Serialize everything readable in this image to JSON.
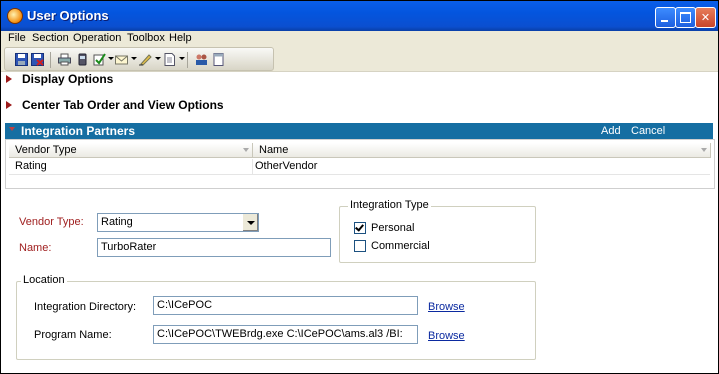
{
  "window": {
    "title": "User Options"
  },
  "menu": [
    "File",
    "Section",
    "Operation",
    "Toolbox",
    "Help"
  ],
  "toolbar": {
    "icons": [
      "save-icon",
      "save-close-icon",
      "print-icon",
      "phone-icon",
      "checklist-icon",
      "mail-icon",
      "pen-icon",
      "document-icon",
      "team-icon",
      "page-icon"
    ]
  },
  "sections": {
    "display": "Display Options",
    "center_tab": "Center Tab Order and View Options",
    "integration": "Integration Partners"
  },
  "integration_actions": {
    "add": "Add",
    "cancel": "Cancel"
  },
  "grid": {
    "columns": [
      "Vendor Type",
      "Name"
    ],
    "rows": [
      {
        "vendor_type": "Rating",
        "name": "OtherVendor"
      }
    ]
  },
  "form": {
    "vendor_type_label": "Vendor Type:",
    "vendor_type_value": "Rating",
    "name_label": "Name:",
    "name_value": "TurboRater"
  },
  "integration_type": {
    "legend": "Integration Type",
    "options": [
      {
        "label": "Personal",
        "checked": true
      },
      {
        "label": "Commercial",
        "checked": false
      }
    ]
  },
  "location": {
    "legend": "Location",
    "dir_label": "Integration Directory:",
    "dir_value": "C:\\ICePOC",
    "prog_label": "Program Name:",
    "prog_value": "C:\\ICePOC\\TWEBrdg.exe C:\\ICePOC\\ams.al3 /BI:",
    "browse": "Browse"
  }
}
